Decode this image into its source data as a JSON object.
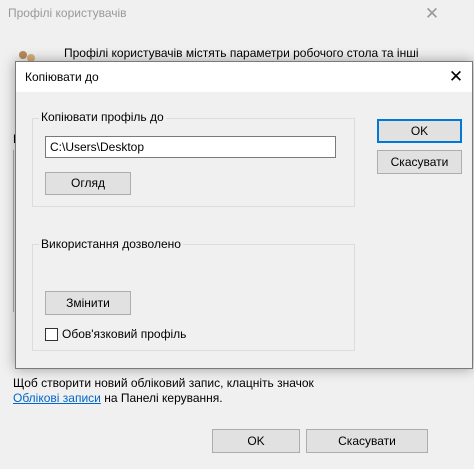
{
  "background_window": {
    "title": "Профілі користувачів",
    "description": "Профілі користувачів містять параметри робочого стола та інші",
    "fragment_label": "П",
    "info_line1": "Щоб створити новий обліковий запис, клацніть значок",
    "info_link": "Облікові записи",
    "info_line2_rest": " на Панелі керування.",
    "ok_label": "OK",
    "cancel_label": "Скасувати"
  },
  "dialog": {
    "title": "Копіювати до",
    "copy_group": {
      "label": "Копіювати профіль до",
      "path_value": "C:\\Users\\Desktop",
      "browse_label": "Огляд"
    },
    "usage_group": {
      "label": "Використання дозволено",
      "change_label": "Змінити",
      "mandatory_label": "Обов'язковий профіль",
      "mandatory_checked": false
    },
    "ok_label": "OK",
    "cancel_label": "Скасувати"
  },
  "colors": {
    "window_bg": "#f0f0f0",
    "button_bg": "#e1e1e1",
    "default_button_border": "#0078d7",
    "link": "#0066cc"
  }
}
